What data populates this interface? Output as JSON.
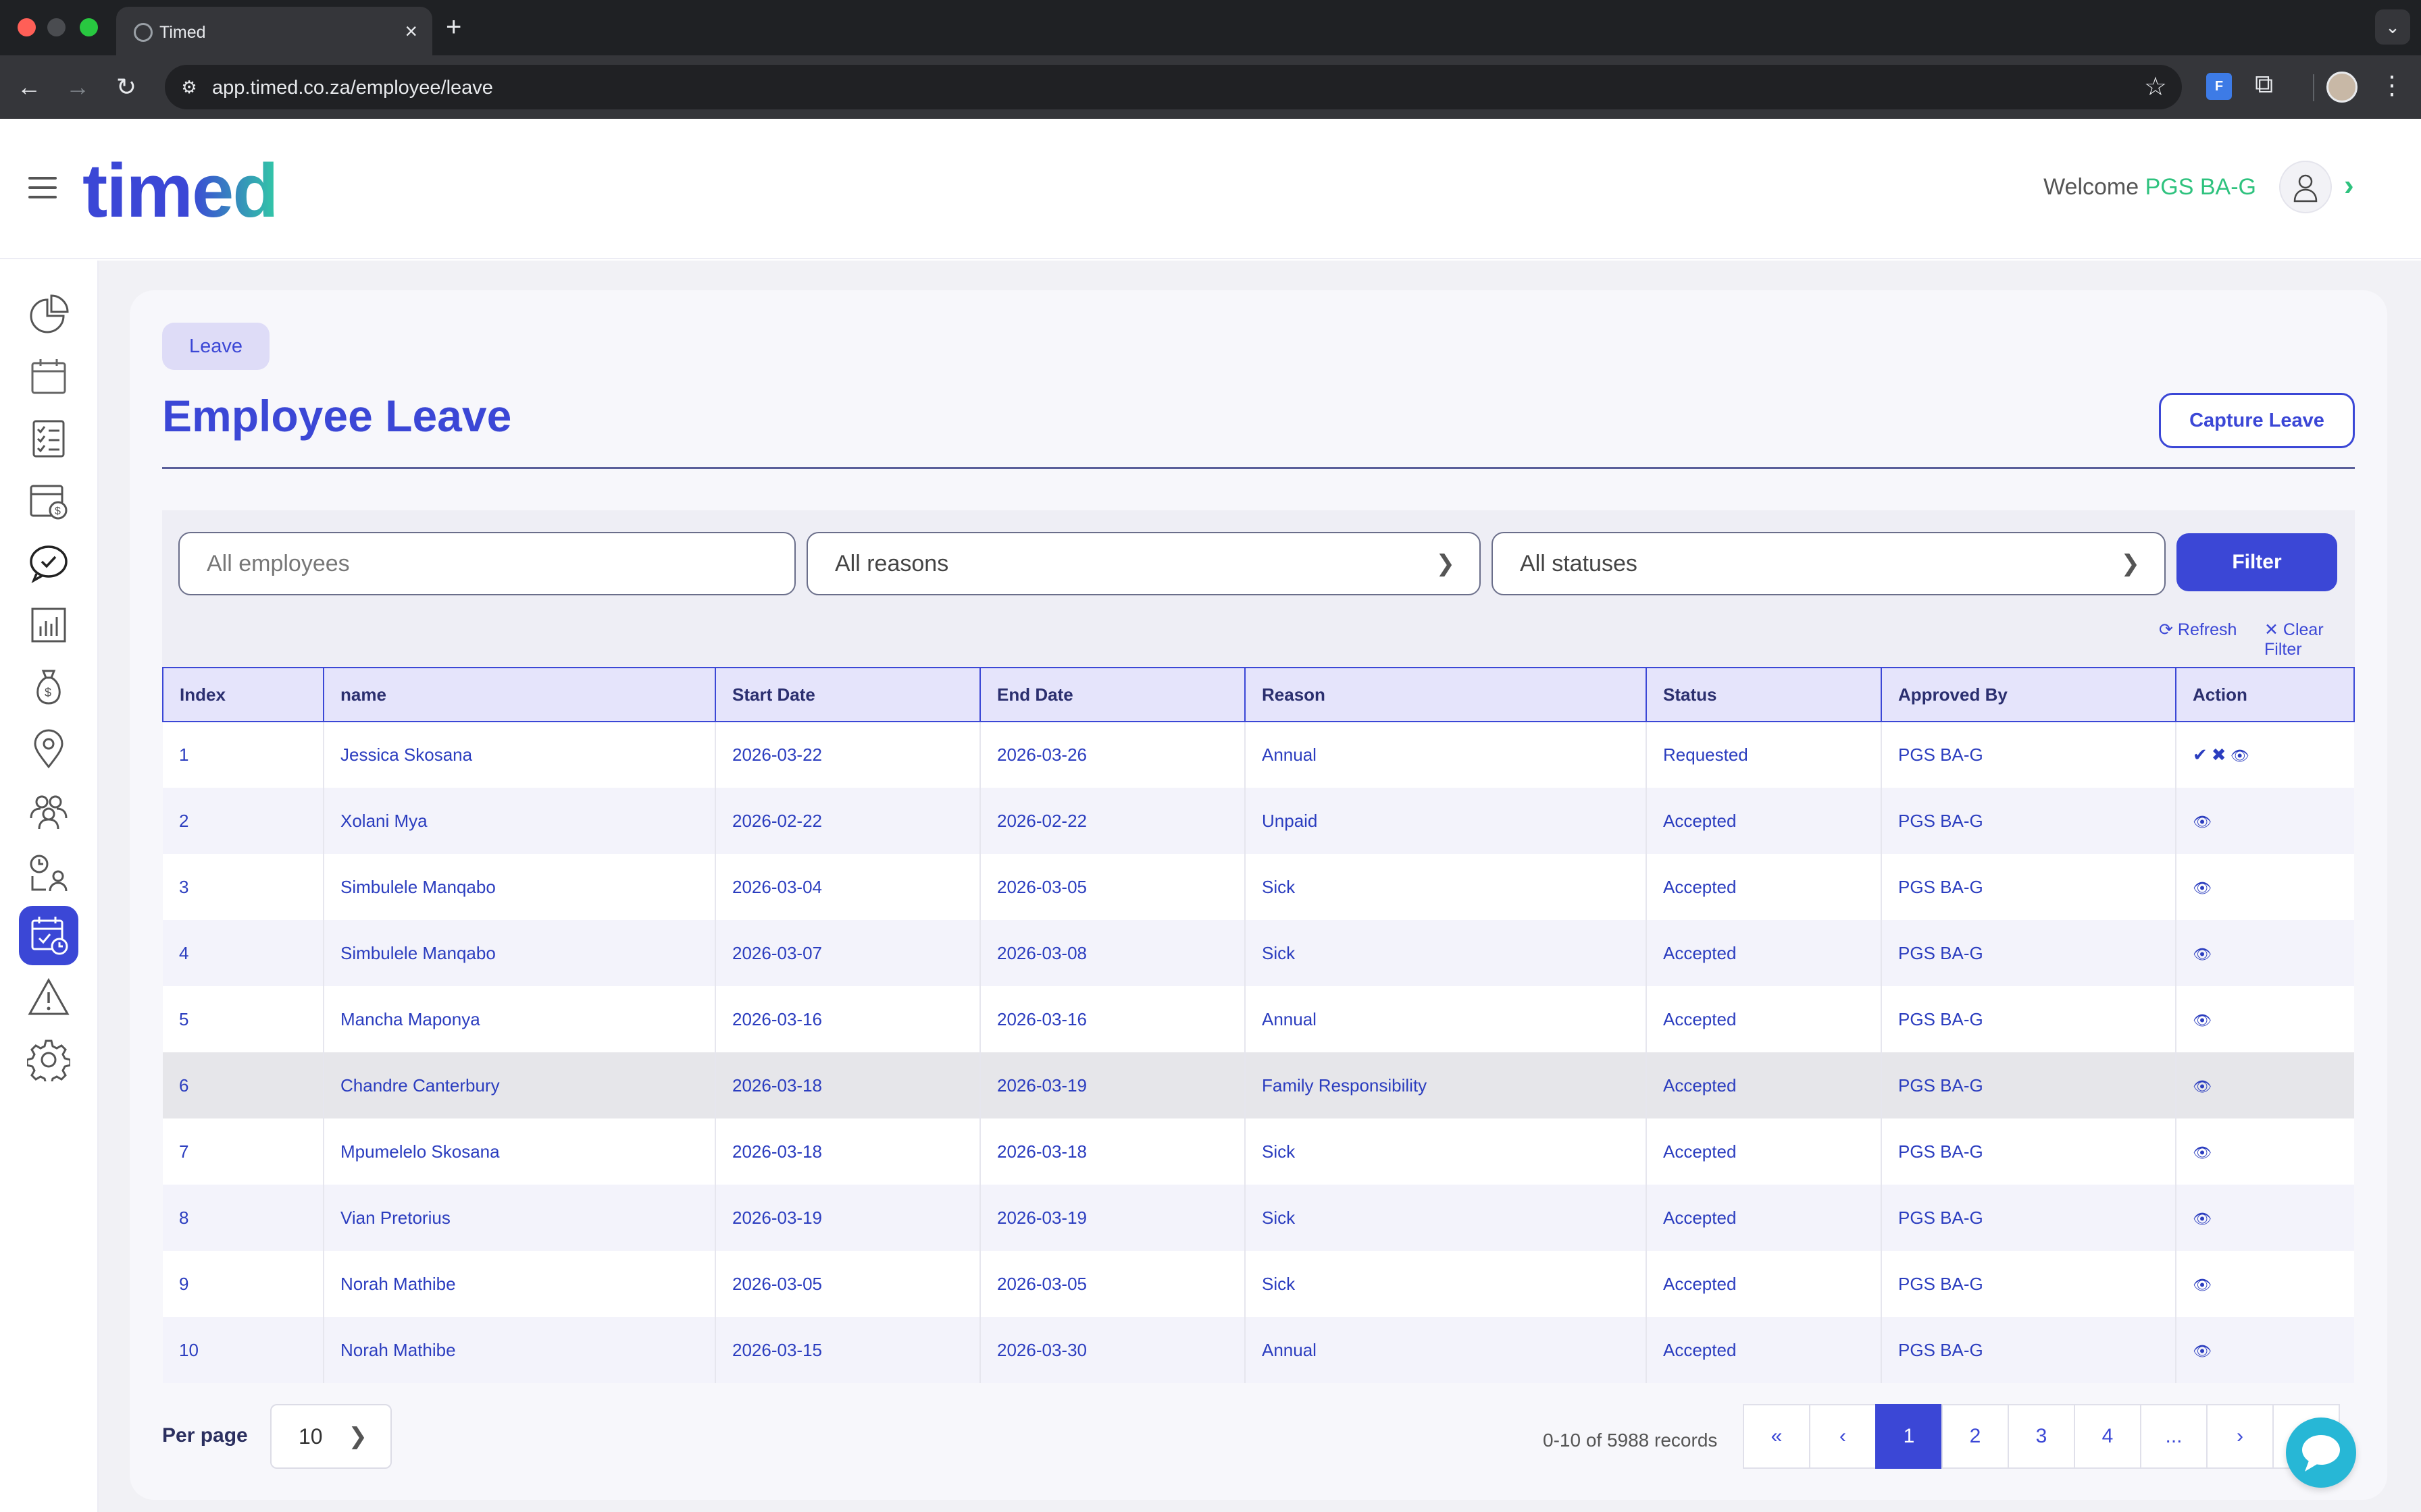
{
  "browser": {
    "tab_title": "Timed",
    "url": "app.timed.co.za/employee/leave",
    "extension_label": "F"
  },
  "header": {
    "logo": "timed",
    "welcome": "Welcome",
    "user": "PGS BA-G"
  },
  "sidebar": {
    "items": [
      {
        "icon": "pie-chart-icon"
      },
      {
        "icon": "calendar-icon"
      },
      {
        "icon": "checklist-icon"
      },
      {
        "icon": "calendar-money-icon"
      },
      {
        "icon": "chat-check-icon"
      },
      {
        "icon": "bar-chart-icon"
      },
      {
        "icon": "money-bag-icon"
      },
      {
        "icon": "location-pin-icon"
      },
      {
        "icon": "team-icon"
      },
      {
        "icon": "clock-transfer-icon"
      },
      {
        "icon": "leave-calendar-icon",
        "active": true
      },
      {
        "icon": "warning-icon"
      },
      {
        "icon": "settings-gear-icon"
      }
    ]
  },
  "page": {
    "breadcrumb": "Leave",
    "title": "Employee Leave",
    "capture_button": "Capture Leave"
  },
  "filters": {
    "employee_placeholder": "All employees",
    "reason_value": "All reasons",
    "status_value": "All statuses",
    "filter_button": "Filter",
    "refresh": "Refresh",
    "clear": "Clear Filter"
  },
  "table": {
    "columns": [
      "Index",
      "name",
      "Start Date",
      "End Date",
      "Reason",
      "Status",
      "Approved By",
      "Action"
    ],
    "rows": [
      {
        "index": "1",
        "name": "Jessica Skosana",
        "start": "2026-03-22",
        "end": "2026-03-26",
        "reason": "Annual",
        "status": "Requested",
        "approved_by": "PGS BA-G",
        "actions": [
          "approve",
          "reject",
          "view"
        ]
      },
      {
        "index": "2",
        "name": "Xolani Mya",
        "start": "2026-02-22",
        "end": "2026-02-22",
        "reason": "Unpaid",
        "status": "Accepted",
        "approved_by": "PGS BA-G",
        "actions": [
          "view"
        ]
      },
      {
        "index": "3",
        "name": "Simbulele Manqabo",
        "start": "2026-03-04",
        "end": "2026-03-05",
        "reason": "Sick",
        "status": "Accepted",
        "approved_by": "PGS BA-G",
        "actions": [
          "view"
        ]
      },
      {
        "index": "4",
        "name": "Simbulele Manqabo",
        "start": "2026-03-07",
        "end": "2026-03-08",
        "reason": "Sick",
        "status": "Accepted",
        "approved_by": "PGS BA-G",
        "actions": [
          "view"
        ]
      },
      {
        "index": "5",
        "name": "Mancha Maponya",
        "start": "2026-03-16",
        "end": "2026-03-16",
        "reason": "Annual",
        "status": "Accepted",
        "approved_by": "PGS BA-G",
        "actions": [
          "view"
        ]
      },
      {
        "index": "6",
        "name": "Chandre Canterbury",
        "start": "2026-03-18",
        "end": "2026-03-19",
        "reason": "Family Responsibility",
        "status": "Accepted",
        "approved_by": "PGS BA-G",
        "actions": [
          "view"
        ],
        "hover": true
      },
      {
        "index": "7",
        "name": "Mpumelelo Skosana",
        "start": "2026-03-18",
        "end": "2026-03-18",
        "reason": "Sick",
        "status": "Accepted",
        "approved_by": "PGS BA-G",
        "actions": [
          "view"
        ]
      },
      {
        "index": "8",
        "name": "Vian Pretorius",
        "start": "2026-03-19",
        "end": "2026-03-19",
        "reason": "Sick",
        "status": "Accepted",
        "approved_by": "PGS BA-G",
        "actions": [
          "view"
        ]
      },
      {
        "index": "9",
        "name": "Norah Mathibe",
        "start": "2026-03-05",
        "end": "2026-03-05",
        "reason": "Sick",
        "status": "Accepted",
        "approved_by": "PGS BA-G",
        "actions": [
          "view"
        ]
      },
      {
        "index": "10",
        "name": "Norah Mathibe",
        "start": "2026-03-15",
        "end": "2026-03-30",
        "reason": "Annual",
        "status": "Accepted",
        "approved_by": "PGS BA-G",
        "actions": [
          "view"
        ]
      }
    ]
  },
  "pagination": {
    "per_page_label": "Per page",
    "per_page_value": "10",
    "records": "0-10 of 5988 records",
    "pages": [
      "1",
      "2",
      "3",
      "4",
      "..."
    ],
    "current_page": "1"
  },
  "colors": {
    "brand_blue": "#3b47d6",
    "brand_green": "#2ec27e",
    "chat": "#27b7d6"
  }
}
